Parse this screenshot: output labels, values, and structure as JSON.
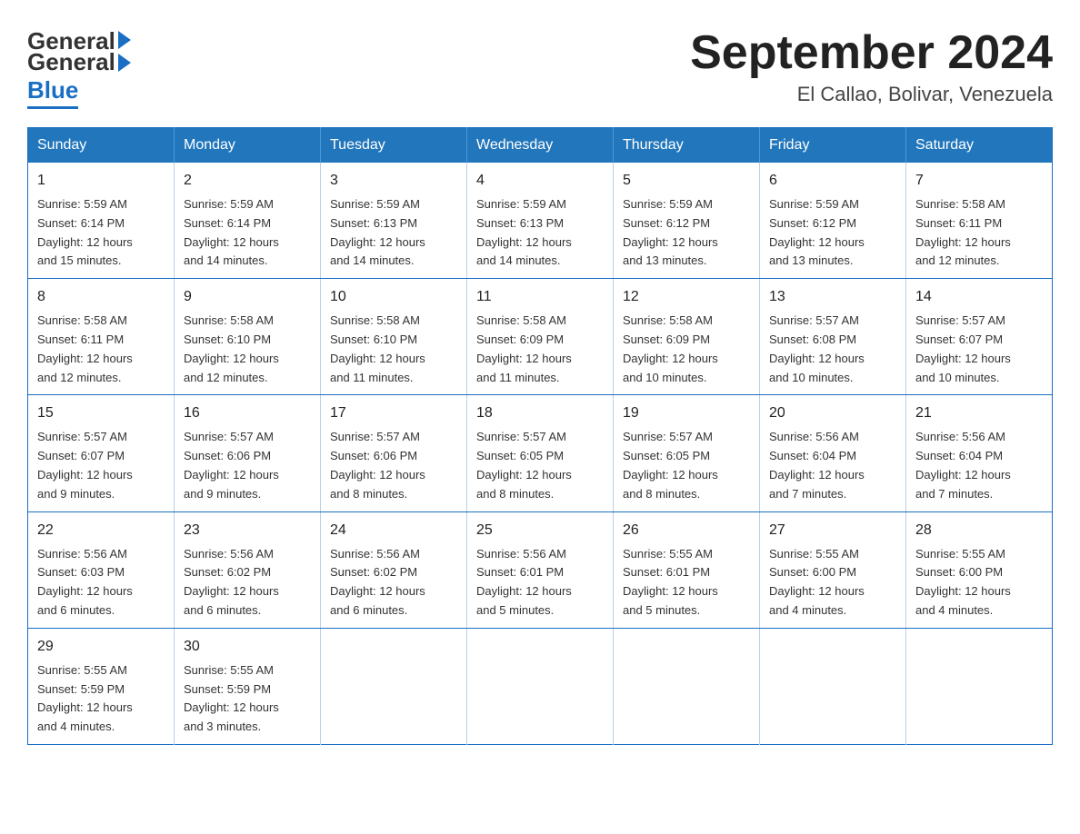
{
  "logo": {
    "general": "General",
    "blue": "Blue"
  },
  "title": "September 2024",
  "subtitle": "El Callao, Bolivar, Venezuela",
  "days_header": [
    "Sunday",
    "Monday",
    "Tuesday",
    "Wednesday",
    "Thursday",
    "Friday",
    "Saturday"
  ],
  "weeks": [
    [
      {
        "day": "1",
        "sunrise": "5:59 AM",
        "sunset": "6:14 PM",
        "daylight": "12 hours and 15 minutes."
      },
      {
        "day": "2",
        "sunrise": "5:59 AM",
        "sunset": "6:14 PM",
        "daylight": "12 hours and 14 minutes."
      },
      {
        "day": "3",
        "sunrise": "5:59 AM",
        "sunset": "6:13 PM",
        "daylight": "12 hours and 14 minutes."
      },
      {
        "day": "4",
        "sunrise": "5:59 AM",
        "sunset": "6:13 PM",
        "daylight": "12 hours and 14 minutes."
      },
      {
        "day": "5",
        "sunrise": "5:59 AM",
        "sunset": "6:12 PM",
        "daylight": "12 hours and 13 minutes."
      },
      {
        "day": "6",
        "sunrise": "5:59 AM",
        "sunset": "6:12 PM",
        "daylight": "12 hours and 13 minutes."
      },
      {
        "day": "7",
        "sunrise": "5:58 AM",
        "sunset": "6:11 PM",
        "daylight": "12 hours and 12 minutes."
      }
    ],
    [
      {
        "day": "8",
        "sunrise": "5:58 AM",
        "sunset": "6:11 PM",
        "daylight": "12 hours and 12 minutes."
      },
      {
        "day": "9",
        "sunrise": "5:58 AM",
        "sunset": "6:10 PM",
        "daylight": "12 hours and 12 minutes."
      },
      {
        "day": "10",
        "sunrise": "5:58 AM",
        "sunset": "6:10 PM",
        "daylight": "12 hours and 11 minutes."
      },
      {
        "day": "11",
        "sunrise": "5:58 AM",
        "sunset": "6:09 PM",
        "daylight": "12 hours and 11 minutes."
      },
      {
        "day": "12",
        "sunrise": "5:58 AM",
        "sunset": "6:09 PM",
        "daylight": "12 hours and 10 minutes."
      },
      {
        "day": "13",
        "sunrise": "5:57 AM",
        "sunset": "6:08 PM",
        "daylight": "12 hours and 10 minutes."
      },
      {
        "day": "14",
        "sunrise": "5:57 AM",
        "sunset": "6:07 PM",
        "daylight": "12 hours and 10 minutes."
      }
    ],
    [
      {
        "day": "15",
        "sunrise": "5:57 AM",
        "sunset": "6:07 PM",
        "daylight": "12 hours and 9 minutes."
      },
      {
        "day": "16",
        "sunrise": "5:57 AM",
        "sunset": "6:06 PM",
        "daylight": "12 hours and 9 minutes."
      },
      {
        "day": "17",
        "sunrise": "5:57 AM",
        "sunset": "6:06 PM",
        "daylight": "12 hours and 8 minutes."
      },
      {
        "day": "18",
        "sunrise": "5:57 AM",
        "sunset": "6:05 PM",
        "daylight": "12 hours and 8 minutes."
      },
      {
        "day": "19",
        "sunrise": "5:57 AM",
        "sunset": "6:05 PM",
        "daylight": "12 hours and 8 minutes."
      },
      {
        "day": "20",
        "sunrise": "5:56 AM",
        "sunset": "6:04 PM",
        "daylight": "12 hours and 7 minutes."
      },
      {
        "day": "21",
        "sunrise": "5:56 AM",
        "sunset": "6:04 PM",
        "daylight": "12 hours and 7 minutes."
      }
    ],
    [
      {
        "day": "22",
        "sunrise": "5:56 AM",
        "sunset": "6:03 PM",
        "daylight": "12 hours and 6 minutes."
      },
      {
        "day": "23",
        "sunrise": "5:56 AM",
        "sunset": "6:02 PM",
        "daylight": "12 hours and 6 minutes."
      },
      {
        "day": "24",
        "sunrise": "5:56 AM",
        "sunset": "6:02 PM",
        "daylight": "12 hours and 6 minutes."
      },
      {
        "day": "25",
        "sunrise": "5:56 AM",
        "sunset": "6:01 PM",
        "daylight": "12 hours and 5 minutes."
      },
      {
        "day": "26",
        "sunrise": "5:55 AM",
        "sunset": "6:01 PM",
        "daylight": "12 hours and 5 minutes."
      },
      {
        "day": "27",
        "sunrise": "5:55 AM",
        "sunset": "6:00 PM",
        "daylight": "12 hours and 4 minutes."
      },
      {
        "day": "28",
        "sunrise": "5:55 AM",
        "sunset": "6:00 PM",
        "daylight": "12 hours and 4 minutes."
      }
    ],
    [
      {
        "day": "29",
        "sunrise": "5:55 AM",
        "sunset": "5:59 PM",
        "daylight": "12 hours and 4 minutes."
      },
      {
        "day": "30",
        "sunrise": "5:55 AM",
        "sunset": "5:59 PM",
        "daylight": "12 hours and 3 minutes."
      },
      null,
      null,
      null,
      null,
      null
    ]
  ],
  "labels": {
    "sunrise": "Sunrise:",
    "sunset": "Sunset:",
    "daylight": "Daylight:"
  }
}
